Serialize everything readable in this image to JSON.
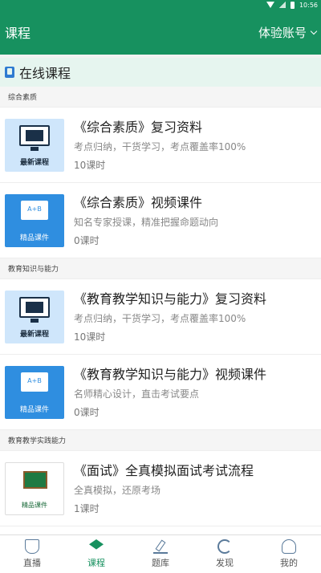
{
  "status": {
    "time": "10:56"
  },
  "header": {
    "title": "课程",
    "account_label": "体验账号"
  },
  "section": {
    "title": "在线课程"
  },
  "categories": [
    {
      "name": "综合素质",
      "items": [
        {
          "thumb_caption": "最新课程",
          "title": "《综合素质》复习资料",
          "desc": "考点归纳，干货学习，考点覆盖率100%",
          "hours": "10课时"
        },
        {
          "thumb_caption": "精品课件",
          "title": "《综合素质》视频课件",
          "desc": "知名专家授课，精准把握命题动向",
          "hours": "0课时"
        }
      ]
    },
    {
      "name": "教育知识与能力",
      "items": [
        {
          "thumb_caption": "最新课程",
          "title": "《教育教学知识与能力》复习资料",
          "desc": "考点归纳，干货学习，考点覆盖率100%",
          "hours": "10课时"
        },
        {
          "thumb_caption": "精品课件",
          "title": "《教育教学知识与能力》视频课件",
          "desc": "名师精心设计，直击考试要点",
          "hours": "0课时"
        }
      ]
    },
    {
      "name": "教育教学实践能力",
      "items": [
        {
          "thumb_caption": "精品课件",
          "title": "《面试》全真模拟面试考试流程",
          "desc": "全真模拟，还原考场",
          "hours": "1课时"
        }
      ]
    }
  ],
  "nav": [
    {
      "label": "直播",
      "icon": "shield-icon"
    },
    {
      "label": "课程",
      "icon": "graduation-cap-icon"
    },
    {
      "label": "题库",
      "icon": "pencil-icon"
    },
    {
      "label": "发现",
      "icon": "refresh-icon"
    },
    {
      "label": "我的",
      "icon": "user-icon"
    }
  ],
  "colors": {
    "primary": "#17915f",
    "accent_blue": "#2f8ee0"
  }
}
